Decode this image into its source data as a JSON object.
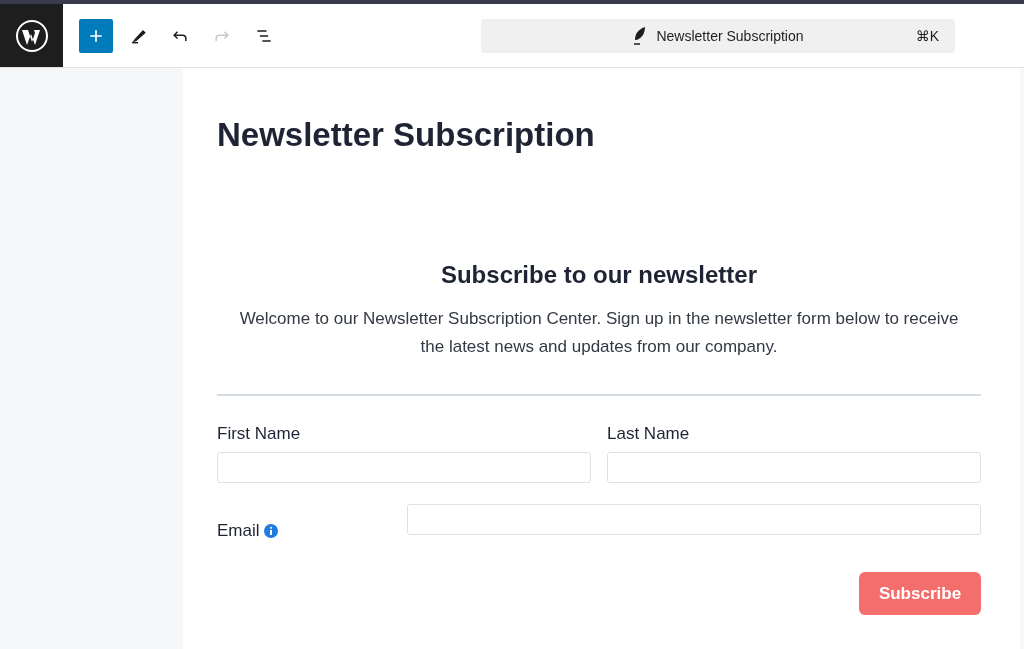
{
  "toolbar": {
    "buttons": [
      {
        "kind": "inserter",
        "selected": true,
        "disabled": false
      },
      {
        "kind": "tools",
        "selected": false,
        "disabled": false
      },
      {
        "kind": "undo",
        "selected": false,
        "disabled": false
      },
      {
        "kind": "redo",
        "selected": false,
        "disabled": true
      },
      {
        "kind": "list",
        "selected": false,
        "disabled": false
      }
    ],
    "command_bar": {
      "title": "Newsletter Subscription",
      "shortcut": "⌘K"
    }
  },
  "page_title": "Newsletter Subscription",
  "form": {
    "heading": "Subscribe to our newsletter",
    "description": "Welcome to our Newsletter Subscription Center. Sign up in the newsletter form below to receive the latest news and updates from our company.",
    "fields": [
      {
        "label": "First Name"
      },
      {
        "label": "Last Name"
      }
    ],
    "email": {
      "label": "Email"
    },
    "submit": "Subscribe"
  }
}
